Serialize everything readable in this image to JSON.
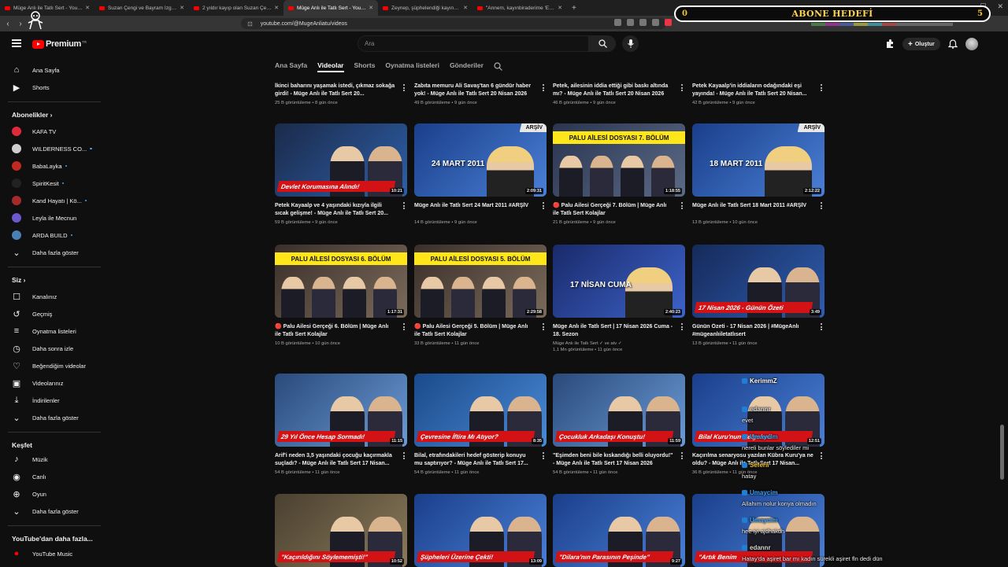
{
  "browser": {
    "tabs": [
      {
        "label": "Müge Anlı ile Tatlı Sert - YouTube"
      },
      {
        "label": "Suzan Çengi ve Bayram İzgi canlı yayında"
      },
      {
        "label": "2 yıldır kayıp olan Suzan Çengi, bir gün"
      },
      {
        "label": "Müge Anlı ile Tatlı Sert - YouTube"
      },
      {
        "label": "Zeynep, şüphelendiği kayınbiraderi"
      },
      {
        "label": "\"Annem, kayınbiraderime 'Eşini bırak"
      }
    ],
    "url": "youtube.com/@MugeAnliatu/videos"
  },
  "overlay": {
    "abone_label": "ABONE HEDEFİ",
    "abone_current": "0",
    "abone_target": "5"
  },
  "header": {
    "logo_text": "Premium",
    "logo_tm": "TR",
    "search_placeholder": "Ara",
    "create_label": "Oluştur"
  },
  "sidebar": {
    "main": [
      {
        "label": "Ana Sayfa",
        "icon": "home-icon"
      },
      {
        "label": "Shorts",
        "icon": "shorts-icon"
      }
    ],
    "subs_title": "Abonelikler",
    "subs": [
      {
        "label": "KAFA TV",
        "color": "#e02a3a",
        "dot": false
      },
      {
        "label": "WILDERNESS CO...",
        "color": "#cfcfcf",
        "dot": true
      },
      {
        "label": "BabaLayka",
        "color": "#c2291f",
        "dot": true
      },
      {
        "label": "SpiritKesit",
        "color": "#222222",
        "dot": true
      },
      {
        "label": "Kand Hayatı | Kö...",
        "color": "#a52a2a",
        "dot": true
      },
      {
        "label": "Leyla ile Mecnun",
        "color": "#6a5acd",
        "dot": false
      },
      {
        "label": "ARDA BUILD",
        "color": "#4a7fb5",
        "dot": true
      }
    ],
    "subs_more": "Daha fazla göster",
    "you_title": "Siz",
    "you": [
      {
        "label": "Kanalınız",
        "icon": "channel-icon"
      },
      {
        "label": "Geçmiş",
        "icon": "history-icon"
      },
      {
        "label": "Oynatma listeleri",
        "icon": "playlist-icon"
      },
      {
        "label": "Daha sonra izle",
        "icon": "clock-icon"
      },
      {
        "label": "Beğendiğim videolar",
        "icon": "like-icon"
      },
      {
        "label": "Videolarınız",
        "icon": "video-icon"
      },
      {
        "label": "İndirilenler",
        "icon": "download-icon"
      }
    ],
    "you_more": "Daha fazla göster",
    "explore_title": "Keşfet",
    "explore": [
      {
        "label": "Müzik",
        "icon": "music-icon"
      },
      {
        "label": "Canlı",
        "icon": "live-icon"
      },
      {
        "label": "Oyun",
        "icon": "gaming-icon"
      }
    ],
    "explore_more": "Daha fazla göster",
    "more_title": "YouTube'dan daha fazla...",
    "more": [
      {
        "label": "YouTube Music",
        "icon": "youtube-music-icon"
      }
    ]
  },
  "channel_tabs": [
    "Ana Sayfa",
    "Videolar",
    "Shorts",
    "Oynatma listeleri",
    "Gönderiler"
  ],
  "channel_tab_active": "Videolar",
  "videos_top": [
    {
      "title": "İkinci baharını yaşamak istedi, çıkmaz sokağa girdi! - Müge Anlı ile Tatlı Sert 20...",
      "meta": "25 B görüntüleme • 8 gün önce"
    },
    {
      "title": "Zabıta memuru Ali Savaş'tan 6 gündür haber yok! - Müge Anlı ile Tatlı Sert 20 Nisan 2026",
      "meta": "49 B görüntüleme • 9 gün önce"
    },
    {
      "title": "Petek, ailesinin iddia ettiği gibi baskı altında mı? - Müge Anlı ile Tatlı Sert 20 Nisan 2026",
      "meta": "46 B görüntüleme • 9 gün önce"
    },
    {
      "title": "Petek Kayaalp'in iddiaların odağındaki eşi yayında! - Müge Anlı ile Tatlı Sert 20 Nisan...",
      "meta": "42 B görüntüleme • 9 gün önce"
    }
  ],
  "videos": [
    {
      "title": "Petek Kayaalp ve 4 yaşındaki kızıyla ilgili sıcak gelişme! - Müge Anlı ile Tatlı Sert 20...",
      "meta": "59 B görüntüleme • 9 gün önce",
      "duration": "10:21",
      "banner": "Devlet Korumasına Alındı!"
    },
    {
      "title": "Müge Anlı ile Tatlı Sert 24 Mart 2011 #ARŞİV",
      "meta": "14 B görüntüleme • 9 gün önce",
      "duration": "2:09:31",
      "date": "24 MART 2011",
      "arsiv": "ARŞİV"
    },
    {
      "title": "🔴 Palu Ailesi Gerçeği 7. Bölüm | Müge Anlı ile Tatlı Sert Kolajlar",
      "meta": "21 B görüntüleme • 9 gün önce",
      "duration": "1:18:55",
      "yellow": "PALU AİLESİ DOSYASI 7. BÖLÜM"
    },
    {
      "title": "Müge Anlı ile Tatlı Sert 18 Mart 2011 #ARŞİV",
      "meta": "13 B görüntüleme • 10 gün önce",
      "duration": "2:12:22",
      "date": "18 MART 2011",
      "arsiv": "ARŞİV"
    },
    {
      "title": "🔴 Palu Ailesi Gerçeği 6. Bölüm | Müge Anlı ile Tatlı Sert Kolajlar",
      "meta": "10 B görüntüleme • 10 gün önce",
      "duration": "1:17:31",
      "yellow": "PALU AİLESİ DOSYASI 6. BÖLÜM"
    },
    {
      "title": "🔴 Palu Ailesi Gerçeği 5. Bölüm | Müge Anlı ile Tatlı Sert Kolajlar",
      "meta": "33 B görüntüleme • 11 gün önce",
      "duration": "2:29:58",
      "yellow": "PALU AİLESİ DOSYASI 5. BÖLÜM"
    },
    {
      "title": "Müge Anlı ile Tatlı Sert | 17 Nisan 2026 Cuma - 18. Sezon",
      "channel": "Müge Anlı ile Tatlı Sert ✓ ve atv ✓",
      "meta": "1,1 Mn görüntüleme • 11 gün önce",
      "duration": "2:40:23",
      "date": "17 NİSAN CUMA"
    },
    {
      "title": "Günün Özeti - 17 Nisan 2026 | #MügeAnlı #mügeanlıiletatlısert",
      "meta": "13 B görüntüleme • 11 gün önce",
      "duration": "3:49",
      "banner": "17 Nisan 2026 - Günün Özeti"
    },
    {
      "title": "Arif'i neden 3,5 yaşındaki çocuğu kaçırmakla suçladı? - Müge Anlı ile Tatlı Sert 17 Nisan...",
      "meta": "54 B görüntüleme • 11 gün önce",
      "duration": "11:15",
      "banner": "29 Yıl Önce Hesap Sormadı!"
    },
    {
      "title": "Bilal, etrafındakileri hedef gösterip konuyu mu saptırıyor? - Müge Anlı ile Tatlı Sert 17...",
      "meta": "54 B görüntüleme • 11 gün önce",
      "duration": "8:35",
      "banner": "Çevresine İftira Mı Atıyor?"
    },
    {
      "title": "\"Eşimden beni bile kıskandığı belli oluyordu!\" - Müge Anlı ile Tatlı Sert 17 Nisan 2026",
      "meta": "54 B görüntüleme • 11 gün önce",
      "duration": "11:59",
      "banner": "Çocukluk Arkadaşı Konuştu!"
    },
    {
      "title": "Kaçırılma senaryosu yazılan Kübra Kuru'ya ne oldu? - Müge Anlı ile Tatlı Sert 17 Nisan...",
      "meta": "36 B görüntüleme • 11 gün önce",
      "duration": "12:51",
      "banner": "Bilal Kuru'nun Belgeleri!"
    },
    {
      "title": "",
      "meta": "",
      "duration": "10:52",
      "banner": "\"Kaçırıldığını Söylememişti!\""
    },
    {
      "title": "",
      "meta": "",
      "duration": "13:09",
      "banner": "Şüpheleri Üzerine Çekti!"
    },
    {
      "title": "",
      "meta": "",
      "duration": "9:27",
      "banner": "\"Dilara'nın Parasının Peşinde\""
    },
    {
      "title": "",
      "meta": "",
      "duration": "",
      "banner": "\"Artık Benim"
    }
  ],
  "chat": [
    {
      "user": "KerimmZ",
      "text": "",
      "color": "#ffffff"
    },
    {
      "user": "edannr",
      "text": "evet",
      "color": "#d9d9d9"
    },
    {
      "user": "Umaycim",
      "text": "nereli bunlar söylediler mi",
      "color": "#3ea6ff"
    },
    {
      "user": "Seferii",
      "text": "hatay",
      "color": "#f1c232"
    },
    {
      "user": "Umaycim",
      "text": "Allahım nolur konya olmadın",
      "color": "#3ea6ff"
    },
    {
      "user": "Umaycim",
      "text": "hee iyi ajdhakdh",
      "color": "#3ea6ff"
    },
    {
      "user": "edannr",
      "text": "Hatay'da aşiret bar mı kadın sürekli aşiret fln dedi dün",
      "color": "#d9d9d9"
    }
  ]
}
